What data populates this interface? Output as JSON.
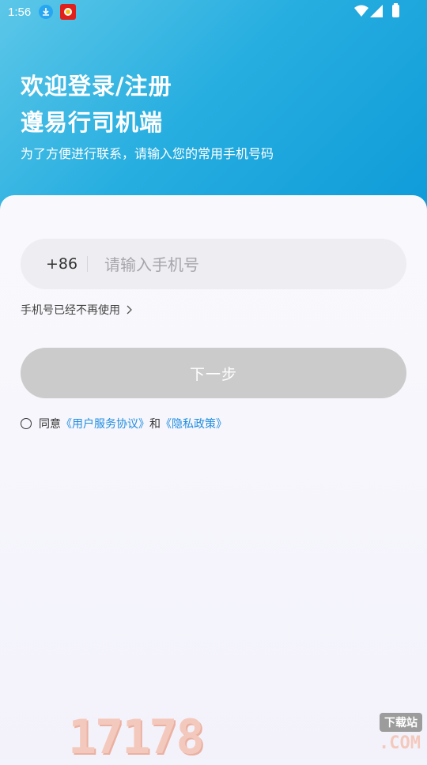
{
  "status_bar": {
    "time": "1:56"
  },
  "header": {
    "title_line1": "欢迎登录/注册",
    "title_line2": "遵易行司机端",
    "subtitle": "为了方便进行联系，请输入您的常用手机号码"
  },
  "form": {
    "country_code": "+86",
    "phone_placeholder": "请输入手机号",
    "phone_value": "",
    "phone_disabled_link": "手机号已经不再使用",
    "next_button": "下一步",
    "agree_prefix": "同意",
    "user_agreement": "《用户服务协议》",
    "agree_and": "和",
    "privacy_policy": "《隐私政策》"
  },
  "watermark": {
    "number": "17178",
    "label": "下载站",
    "domain": ".COM"
  },
  "colors": {
    "header_gradient_start": "#5cc7e8",
    "header_gradient_end": "#0d9ad8",
    "link": "#1f8de0",
    "button_disabled": "#cbcbcb"
  }
}
